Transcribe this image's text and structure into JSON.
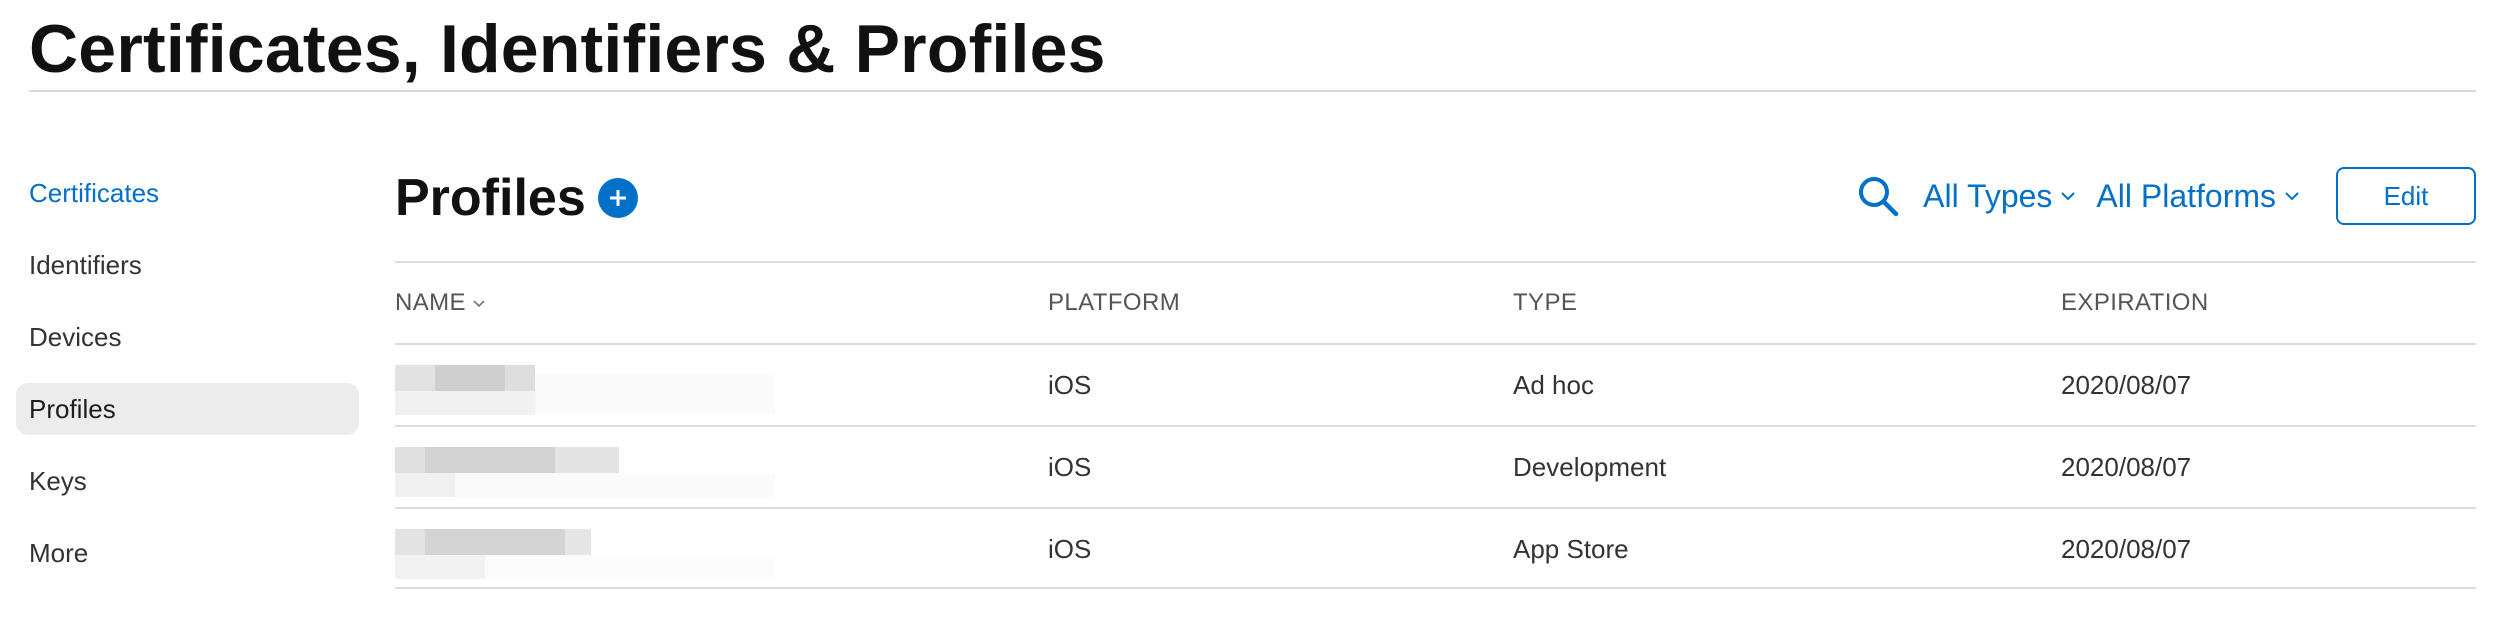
{
  "page": {
    "title": "Certificates, Identifiers & Profiles"
  },
  "sidebar": {
    "items": [
      {
        "label": "Certificates"
      },
      {
        "label": "Identifiers"
      },
      {
        "label": "Devices"
      },
      {
        "label": "Profiles"
      },
      {
        "label": "Keys"
      },
      {
        "label": "More"
      }
    ],
    "active_index": 3
  },
  "section": {
    "title": "Profiles"
  },
  "toolbar": {
    "filter_type": "All Types",
    "filter_platform": "All Platforms",
    "edit_label": "Edit"
  },
  "table": {
    "columns": {
      "name": "NAME",
      "platform": "PLATFORM",
      "type": "TYPE",
      "expiration": "EXPIRATION"
    },
    "rows": [
      {
        "platform": "iOS",
        "type": "Ad hoc",
        "expiration": "2020/08/07"
      },
      {
        "platform": "iOS",
        "type": "Development",
        "expiration": "2020/08/07"
      },
      {
        "platform": "iOS",
        "type": "App Store",
        "expiration": "2020/08/07"
      }
    ]
  },
  "colors": {
    "accent": "#0070c9",
    "selected_bg": "#ececec",
    "divider": "#dcdcdc"
  },
  "icons": {
    "add": "plus-circle-icon",
    "search": "search-icon",
    "chevron": "chevron-down-icon"
  }
}
